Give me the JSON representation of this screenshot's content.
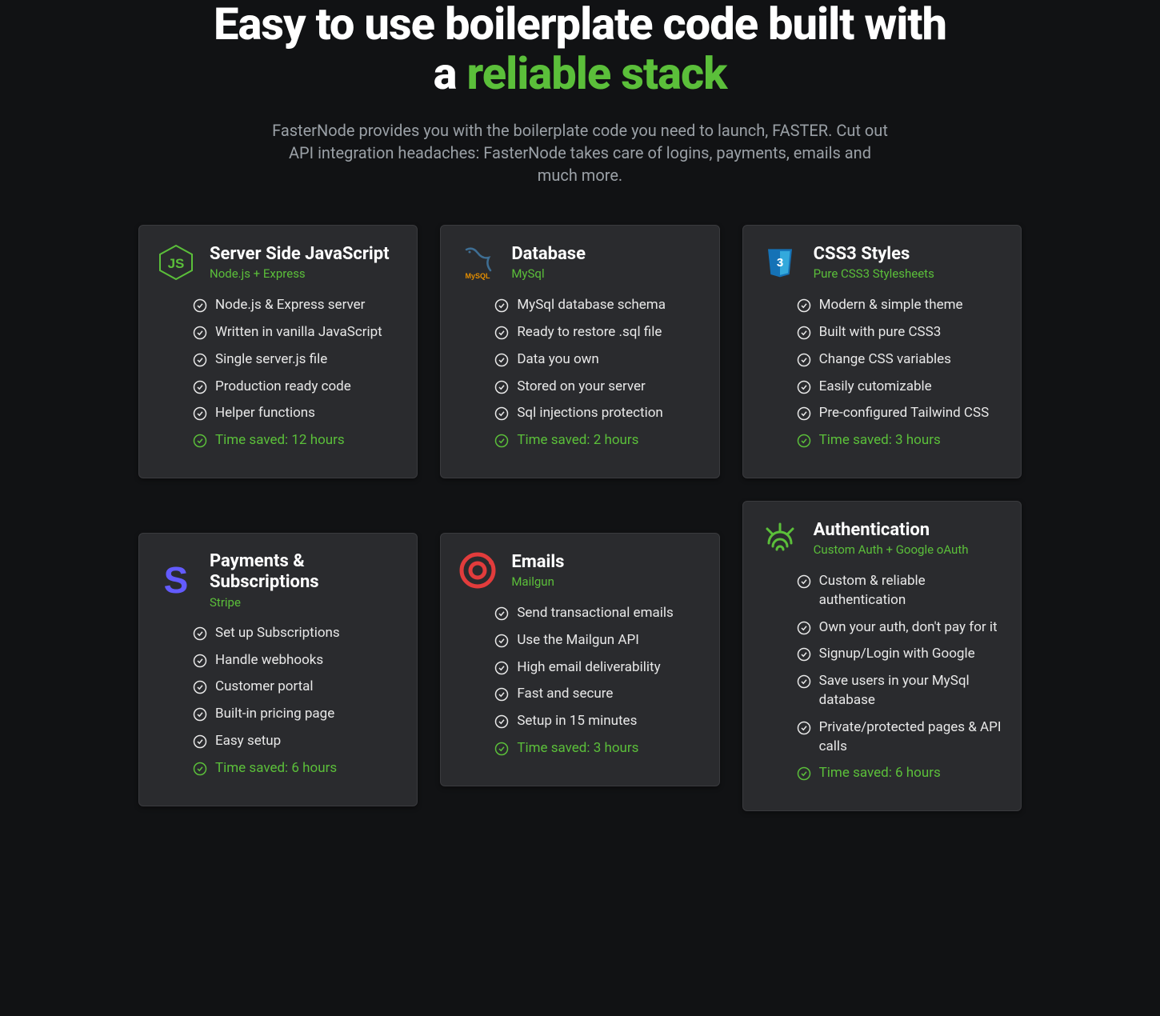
{
  "hero": {
    "title_plain": "Easy to use boilerplate code built with a ",
    "title_accent": "reliable stack",
    "subtitle": "FasterNode provides you with the boilerplate code you need to launch, FASTER. Cut out API integration headaches: FasterNode takes care of logins, payments, emails and much more."
  },
  "cards": [
    {
      "icon": "nodejs",
      "title": "Server Side JavaScript",
      "subtitle": "Node.js + Express",
      "features": [
        "Node.js & Express server",
        "Written in vanilla JavaScript",
        "Single server.js file",
        "Production ready code",
        "Helper functions"
      ],
      "time_saved": "Time saved: 12 hours"
    },
    {
      "icon": "mysql",
      "title": "Database",
      "subtitle": "MySql",
      "features": [
        "MySql database schema",
        "Ready to restore .sql file",
        "Data you own",
        "Stored on your server",
        "Sql injections protection"
      ],
      "time_saved": "Time saved: 2 hours"
    },
    {
      "icon": "css3",
      "title": "CSS3 Styles",
      "subtitle": "Pure CSS3 Stylesheets",
      "features": [
        "Modern & simple theme",
        "Built with pure CSS3",
        "Change CSS variables",
        "Easily cutomizable",
        "Pre-configured Tailwind CSS"
      ],
      "time_saved": "Time saved: 3 hours"
    },
    {
      "icon": "stripe",
      "title": "Payments & Subscriptions",
      "subtitle": "Stripe",
      "features": [
        "Set up Subscriptions",
        "Handle webhooks",
        "Customer portal",
        "Built-in pricing page",
        "Easy setup"
      ],
      "time_saved": "Time saved: 6 hours"
    },
    {
      "icon": "mailgun",
      "title": "Emails",
      "subtitle": "Mailgun",
      "features": [
        "Send transactional emails",
        "Use the Mailgun API",
        "High email deliverability",
        "Fast and secure",
        "Setup in 15 minutes"
      ],
      "time_saved": "Time saved: 3 hours"
    },
    {
      "icon": "auth",
      "title": "Authentication",
      "subtitle": "Custom Auth + Google oAuth",
      "features": [
        "Custom & reliable authentication",
        "Own your auth, don't pay for it",
        "Signup/Login with Google",
        "Save users in your MySql database",
        "Private/protected pages & API calls"
      ],
      "time_saved": "Time saved: 6 hours"
    }
  ]
}
